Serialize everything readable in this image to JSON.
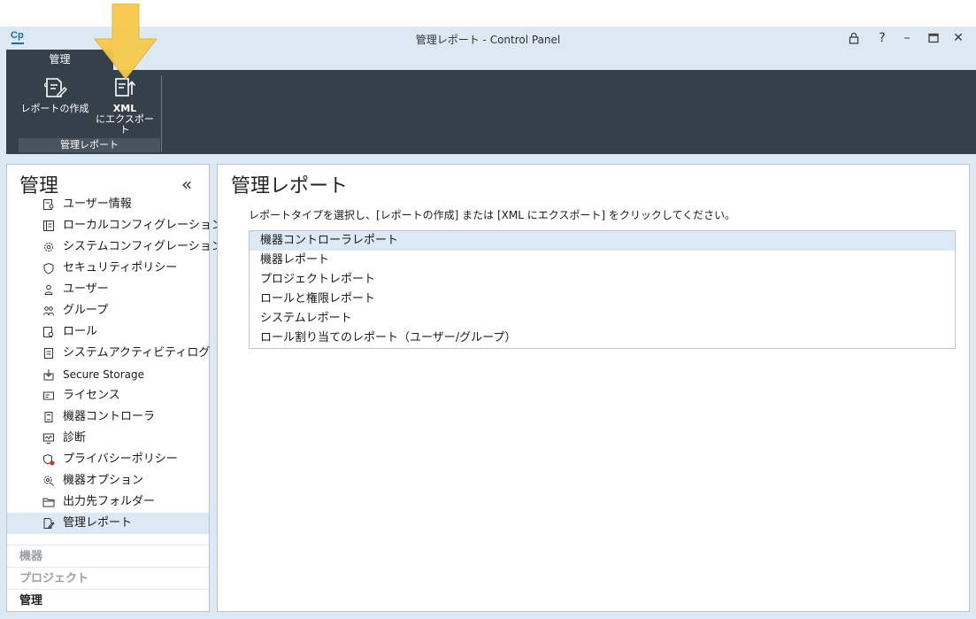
{
  "window": {
    "logo": "Cp",
    "title": "管理レポート - Control Panel",
    "buttons": {
      "lock": "🔒",
      "help": "?",
      "minimize": "–",
      "maximize": "☐",
      "close": "✕"
    }
  },
  "ribbon": {
    "tab": "管理",
    "buttons": [
      {
        "label": "レポートの作成"
      },
      {
        "label_line1": "XML",
        "label_line2": "にエクスポート"
      }
    ],
    "group_label": "管理レポート"
  },
  "sidebar": {
    "title": "管理",
    "collapse": "«",
    "items": [
      {
        "label": "ユーザー情報"
      },
      {
        "label": "ローカルコンフィグレーション"
      },
      {
        "label": "システムコンフィグレーション"
      },
      {
        "label": "セキュリティポリシー"
      },
      {
        "label": "ユーザー"
      },
      {
        "label": "グループ"
      },
      {
        "label": "ロール"
      },
      {
        "label": "システムアクティビティログ"
      },
      {
        "label": "Secure Storage"
      },
      {
        "label": "ライセンス"
      },
      {
        "label": "機器コントローラ"
      },
      {
        "label": "診断"
      },
      {
        "label": "プライバシーポリシー"
      },
      {
        "label": "機器オプション"
      },
      {
        "label": "出力先フォルダー"
      },
      {
        "label": "管理レポート"
      }
    ],
    "sections": [
      {
        "label": "機器"
      },
      {
        "label": "プロジェクト"
      },
      {
        "label": "管理"
      }
    ]
  },
  "main": {
    "title": "管理レポート",
    "instruction": "レポートタイプを選択し、[レポートの作成] または [XML にエクスポート] をクリックしてください。",
    "report_types": [
      {
        "label": "機器コントローラレポート"
      },
      {
        "label": "機器レポート"
      },
      {
        "label": "プロジェクトレポート"
      },
      {
        "label": "ロールと権限レポート"
      },
      {
        "label": "システムレポート"
      },
      {
        "label": "ロール割り当てのレポート（ユーザー/グループ）"
      }
    ]
  },
  "colors": {
    "ribbon_dark": "#36404b",
    "chrome_light": "#dce8f2",
    "selection": "#dce9f5",
    "arrow": "#f7c948",
    "brand": "#1b6bb5"
  }
}
